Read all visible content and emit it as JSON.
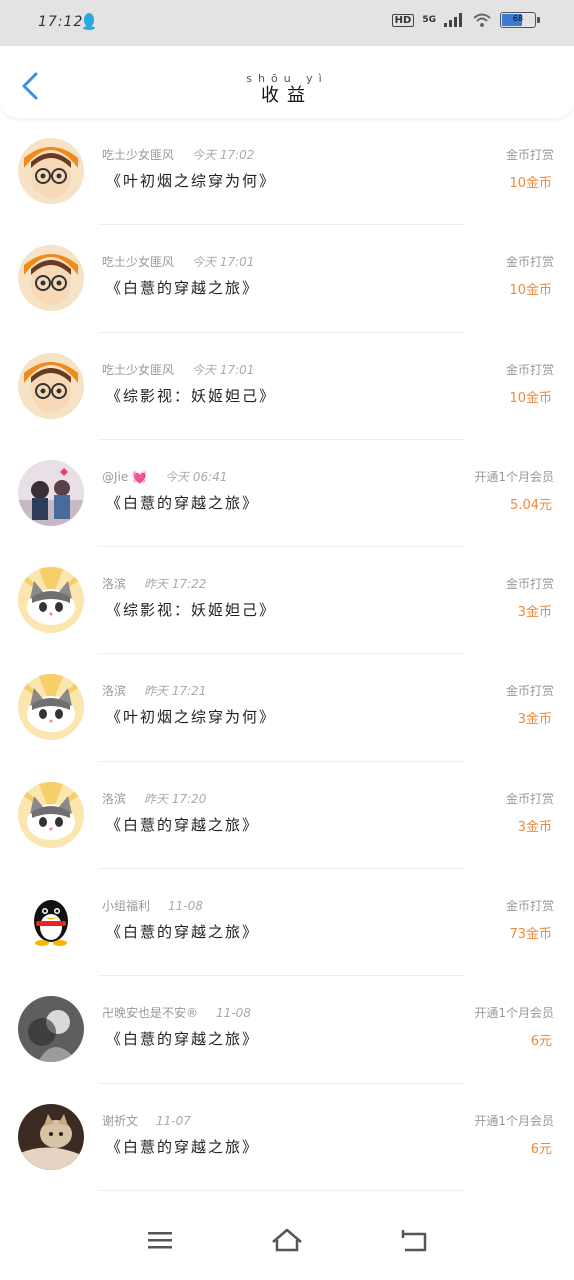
{
  "status_bar": {
    "time": "17:12",
    "network": "5G",
    "hd": "HD",
    "battery": "68"
  },
  "header": {
    "title_pinyin": "shōu yì",
    "title": "收益"
  },
  "colors": {
    "accent": "#3a8ee6",
    "amount": "#ef8a3c"
  },
  "earnings": [
    {
      "user": "吃土少女匪风",
      "time": "今天 17:02",
      "book": "《叶初烟之综穿为何》",
      "action": "金币打赏",
      "amount": "10金币",
      "avatar": "girl-glasses"
    },
    {
      "user": "吃土少女匪风",
      "time": "今天 17:01",
      "book": "《白薏的穿越之旅》",
      "action": "金币打赏",
      "amount": "10金币",
      "avatar": "girl-glasses"
    },
    {
      "user": "吃土少女匪风",
      "time": "今天 17:01",
      "book": "《综影视：妖姬妲己》",
      "action": "金币打赏",
      "amount": "10金币",
      "avatar": "girl-glasses"
    },
    {
      "user": "@Jie 💓",
      "time": "今天 06:41",
      "book": "《白薏的穿越之旅》",
      "action": "开通1个月会员",
      "amount": "5.04元",
      "avatar": "couple-photo"
    },
    {
      "user": "洛滨",
      "time": "昨天 17:22",
      "book": "《综影视：妖姬妲己》",
      "action": "金币打赏",
      "amount": "3金币",
      "avatar": "cat-cartoon"
    },
    {
      "user": "洛滨",
      "time": "昨天 17:21",
      "book": "《叶初烟之综穿为何》",
      "action": "金币打赏",
      "amount": "3金币",
      "avatar": "cat-cartoon"
    },
    {
      "user": "洛滨",
      "time": "昨天 17:20",
      "book": "《白薏的穿越之旅》",
      "action": "金币打赏",
      "amount": "3金币",
      "avatar": "cat-cartoon"
    },
    {
      "user": "小组福利",
      "time": "11-08",
      "book": "《白薏的穿越之旅》",
      "action": "金币打赏",
      "amount": "73金币",
      "avatar": "penguin"
    },
    {
      "user": "卍晚安也是不安®",
      "time": "11-08",
      "book": "《白薏的穿越之旅》",
      "action": "开通1个月会员",
      "amount": "6元",
      "avatar": "gray-photo"
    },
    {
      "user": "谢祈文",
      "time": "11-07",
      "book": "《白薏的穿越之旅》",
      "action": "开通1个月会员",
      "amount": "6元",
      "avatar": "cat-photo"
    }
  ]
}
